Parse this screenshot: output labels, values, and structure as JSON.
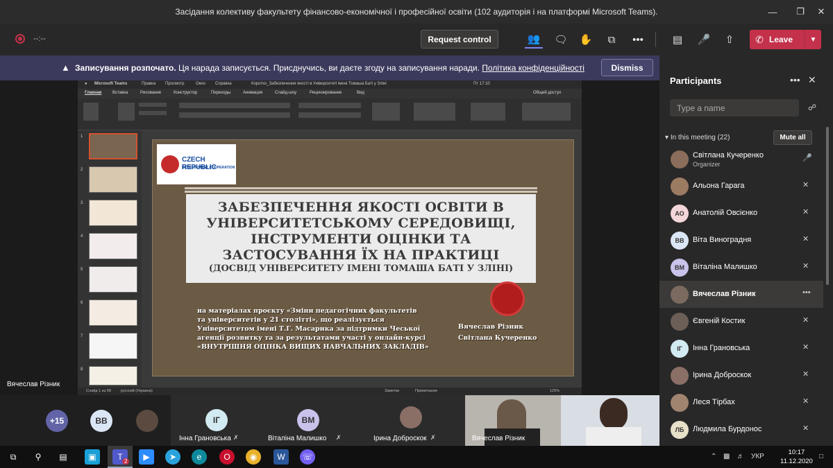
{
  "window": {
    "title": "Засідання колективу факультету фінансово-економічної і професійної освіти (102 аудиторія і на платформі Microsoft Teams)."
  },
  "toolbar": {
    "timer": "--:--",
    "request_control": "Request control",
    "leave": "Leave"
  },
  "banner": {
    "bold": "Записування розпочато.",
    "message": "Ця нарада записується. Присднучись, ви даєте згоду на записування наради.",
    "link": "Політика конфіденційності",
    "dismiss": "Dismiss"
  },
  "presentation": {
    "app_menu": [
      "Microsoft Teams",
      "Правка",
      "Просмотр",
      "Окно",
      "Справка"
    ],
    "doc_title": "Коротко_Забезпечення якості в Університеті імені Томаша Баті у Зліні",
    "clock": "Пт 17:10",
    "ribbon_tabs": [
      "Главная",
      "Вставка",
      "Рисование",
      "Конструктор",
      "Переходы",
      "Анимация",
      "Слайд-шоу",
      "Рецензирование",
      "Вид"
    ],
    "share": "Общий доступ",
    "status_left": "Слайд 1 из 58",
    "status_lang": "русский (Украина)",
    "status_notes": "Заметки",
    "status_comments": "Примечания",
    "zoom": "125%",
    "slide_numbers": [
      "1",
      "2",
      "3",
      "4",
      "5",
      "6",
      "7",
      "8"
    ],
    "slide": {
      "logo_line1": "CZECH REPUBLIC",
      "logo_line2": "DEVELOPMENT COOPERATION",
      "title_lines": [
        "ЗАБЕЗПЕЧЕННЯ ЯКОСТІ ОСВІТИ В",
        "УНІВЕРСИТЕТСЬКОМУ СЕРЕДОВИЩІ,",
        "ІНСТРУМЕНТИ ОЦІНКИ ТА",
        "ЗАСТОСУВАННЯ ЇХ НА ПРАКТИЦІ"
      ],
      "subtitle": "(ДОСВІД УНІВЕРСИТЕТУ ІМЕНІ ТОМАША БАТІ У ЗЛІНІ)",
      "desc_lines": [
        "на матеріалах проєкту «Зміни педагогічних факультетів",
        "та університетів у 21 столітті», що реалізується",
        "Університетом імені Т.Г. Масарика за підтримки Чеської",
        "агенції розвитку та за результатами участі у онлайн-курсі",
        "«ВНУТРІШНЯ ОЦІНКА ВИЩИХ НАВЧАЛЬНИХ ЗАКЛАДІВ»"
      ],
      "authors": [
        "Вячеслав Різник",
        "Світлана Кучеренко"
      ]
    }
  },
  "presenter_label": "Вячеслав Різник",
  "gallery": {
    "more": "+15",
    "tiles": [
      {
        "initials": "ВВ",
        "name": ""
      },
      {
        "initials": "",
        "name": ""
      },
      {
        "initials": "ІГ",
        "name": "Інна Грановська"
      },
      {
        "initials": "ВМ",
        "name": "Віталіна Малишко"
      },
      {
        "initials": "",
        "name": "Ірина Доброскок"
      },
      {
        "initials": "",
        "name": "Вячеслав Різник"
      },
      {
        "initials": "",
        "name": ""
      }
    ]
  },
  "participants": {
    "title": "Participants",
    "search_placeholder": "Type a name",
    "in_meeting": "In this meeting (22)",
    "mute_all": "Mute all",
    "list": [
      {
        "name": "Світлана Кучеренко",
        "role": "Organizer",
        "initials": "",
        "color": "#8a6d5a",
        "mic": "on"
      },
      {
        "name": "Альона Гарага",
        "role": "",
        "initials": "",
        "color": "#9c7b63",
        "mic": "off"
      },
      {
        "name": "Анатолій Овсієнко",
        "role": "",
        "initials": "АО",
        "color": "#f3d6d8",
        "mic": "off"
      },
      {
        "name": "Віта Виноградня",
        "role": "",
        "initials": "ВВ",
        "color": "#dbe6f5",
        "mic": "off"
      },
      {
        "name": "Віталіна Малишко",
        "role": "",
        "initials": "ВМ",
        "color": "#c9c2ea",
        "mic": "off"
      },
      {
        "name": "Вячеслав Різник",
        "role": "",
        "initials": "",
        "color": "#7a6a60",
        "mic": "more"
      },
      {
        "name": "Євгеній Костик",
        "role": "",
        "initials": "",
        "color": "#6b5f58",
        "mic": "off"
      },
      {
        "name": "Інна Грановська",
        "role": "",
        "initials": "ІГ",
        "color": "#d2eaf2",
        "mic": "off"
      },
      {
        "name": "Ірина Доброскок",
        "role": "",
        "initials": "",
        "color": "#8a6f66",
        "mic": "off"
      },
      {
        "name": "Леся Тірбах",
        "role": "",
        "initials": "",
        "color": "#a08470",
        "mic": "off"
      },
      {
        "name": "Людмила Бурдонос",
        "role": "",
        "initials": "ЛБ",
        "color": "#e6e0c8",
        "mic": "off"
      }
    ]
  },
  "taskbar": {
    "lang": "УКР",
    "time": "10:17",
    "date": "11.12.2020",
    "teams_badge": "2"
  },
  "colors": {
    "leave": "#c4314b",
    "banner": "#3b3a5c",
    "panel": "#292828",
    "slide_bg": "#6b5a44"
  }
}
